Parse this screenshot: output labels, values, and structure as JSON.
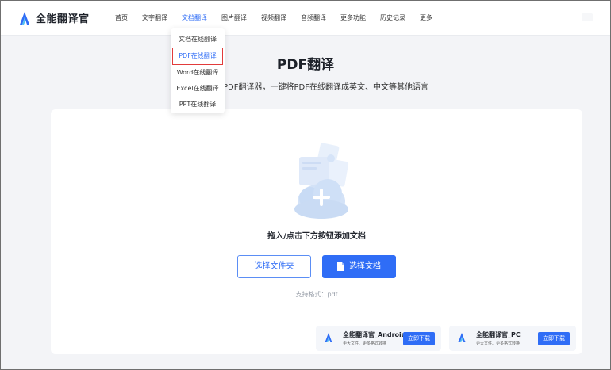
{
  "header": {
    "app_name": "全能翻译官",
    "nav": [
      "首页",
      "文字翻译",
      "文档翻译",
      "图片翻译",
      "视频翻译",
      "音频翻译",
      "更多功能",
      "历史记录",
      "更多"
    ],
    "active_nav": "文档翻译"
  },
  "dropdown": {
    "items": [
      "文档在线翻译",
      "PDF在线翻译",
      "Word在线翻译",
      "Excel在线翻译",
      "PPT在线翻译"
    ],
    "selected": "PDF在线翻译"
  },
  "main": {
    "title": "PDF翻译",
    "subtitle": "PDF翻译器，一键将PDF在线翻译成英文、中文等其他语言",
    "drop_hint": "拖入/点击下方按钮添加文档",
    "select_folder_label": "选择文件夹",
    "select_doc_label": "选择文档",
    "formats_label": "支持格式：pdf"
  },
  "promos": [
    {
      "title": "全能翻译官_Android",
      "desc": "更大文件、更多格式转换",
      "button": "立即下载"
    },
    {
      "title": "全能翻译官_PC",
      "desc": "更大文件、更多格式转换",
      "button": "立即下载"
    }
  ],
  "colors": {
    "accent": "#2f6df6",
    "highlight_border": "#e23b3b",
    "page_bg": "#f3f4f7"
  },
  "icons": [
    "logo-icon",
    "cloud-upload-icon",
    "document-icon"
  ]
}
